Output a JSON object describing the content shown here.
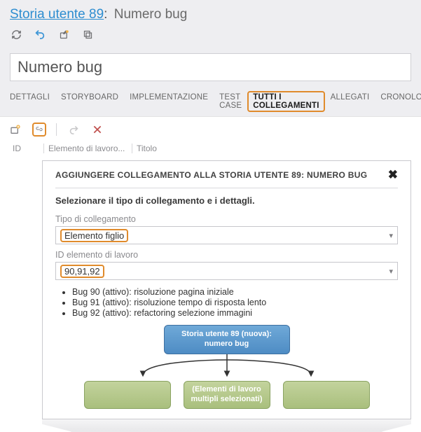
{
  "header": {
    "story_link": "Storia utente 89",
    "story_suffix": "Numero bug"
  },
  "main_input": {
    "value": "Numero bug"
  },
  "tabs": {
    "list": [
      {
        "label": "DETTAGLI"
      },
      {
        "label": "STORYBOARD"
      },
      {
        "label": "IMPLEMENTAZIONE"
      },
      {
        "label": "TEST CASE"
      },
      {
        "label": "TUTTI I COLLEGAMENTI"
      },
      {
        "label": "ALLEGATI"
      },
      {
        "label": "CRONOLOGIA"
      }
    ]
  },
  "columns": {
    "id": "ID",
    "elemento": "Elemento di lavoro...",
    "titolo": "Titolo"
  },
  "dialog": {
    "title": "AGGIUNGERE COLLEGAMENTO ALLA STORIA UTENTE 89: NUMERO BUG",
    "note": "Selezionare il tipo di collegamento e i dettagli.",
    "link_type_label": "Tipo di collegamento",
    "link_type_value": "Elemento figlio",
    "workitem_label": "ID elemento di lavoro",
    "workitem_value": "90,91,92",
    "items": [
      "Bug 90 (attivo): risoluzione pagina iniziale",
      "Bug 91 (attivo): risoluzione tempo di risposta lento",
      "Bug 92 (attivo): refactoring selezione immagini"
    ]
  },
  "diagram": {
    "parent": "Storia utente 89 (nuova): numero bug",
    "selected_child": "(Elementi di lavoro multipli selezionati)"
  }
}
